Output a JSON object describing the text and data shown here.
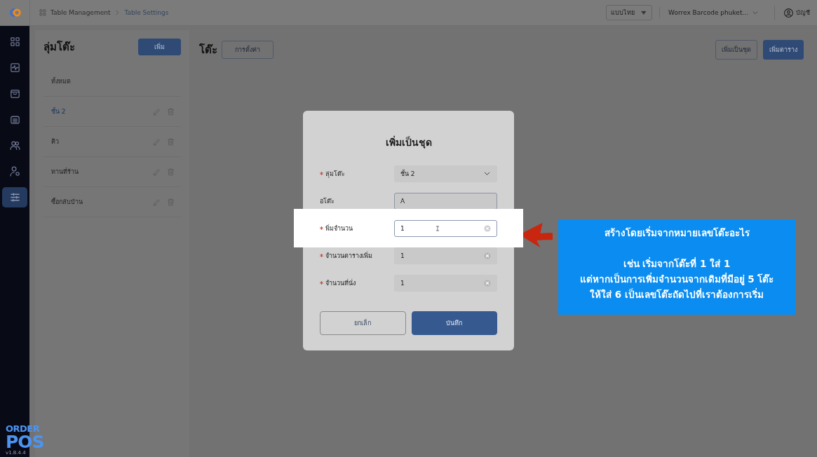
{
  "header": {
    "breadcrumb": [
      "Table Management",
      "Table Settings"
    ],
    "language": "แบบไทย",
    "store": "Worrex Barcode phuket...",
    "account": "บัญชี"
  },
  "sidebar": {
    "items": [
      {
        "kind": "grid",
        "selected": false
      },
      {
        "kind": "pulse",
        "selected": false
      },
      {
        "kind": "bag",
        "selected": false
      },
      {
        "kind": "archive",
        "selected": false
      },
      {
        "kind": "users",
        "selected": false
      },
      {
        "kind": "user-gear",
        "selected": false
      },
      {
        "kind": "sliders",
        "selected": true
      }
    ],
    "brand": {
      "line_1": "ORDER",
      "line_2": "POS",
      "version": "v1.8.4.4"
    }
  },
  "groups_panel": {
    "title": "ลุ่มโต๊ะ",
    "add_button": "เพิ่ม",
    "items": [
      {
        "label": "ทั้งหมด",
        "selected": false,
        "editable": false
      },
      {
        "label": "ชั้น 2",
        "selected": true,
        "editable": true
      },
      {
        "label": "คิว",
        "selected": false,
        "editable": true
      },
      {
        "label": "ทานที่ร้าน",
        "selected": false,
        "editable": true
      },
      {
        "label": "ซื้อกลับบ้าน",
        "selected": false,
        "editable": true
      }
    ]
  },
  "tables_panel": {
    "title": "โต๊ะ",
    "settings_button": "การตั้งค่า",
    "buttons": [
      {
        "label": "เพิ่มเป็นชุด",
        "kind": "outline"
      },
      {
        "label": "เพิ่มตาราง",
        "kind": "primary"
      }
    ]
  },
  "dialog": {
    "title": "เพิ่มเป็นชุด",
    "fields": [
      {
        "label": "ลุ่มโต๊ะ",
        "required": true,
        "kind": "select",
        "value": "ชั้น 2",
        "highlighted": false
      },
      {
        "label": "อโต๊ะ",
        "required": false,
        "kind": "text",
        "value": "A",
        "highlighted": false
      },
      {
        "label": "พิ่มจำนวน",
        "required": true,
        "kind": "number",
        "value": "1",
        "highlighted": true
      },
      {
        "label": "จำนวนตารางเพิ่ม",
        "required": true,
        "kind": "number",
        "value": "1",
        "highlighted": false
      },
      {
        "label": "จำนวนที่นั่ง",
        "required": true,
        "kind": "number",
        "value": "1",
        "highlighted": false
      }
    ],
    "cancel_button": "ยกเล็ก",
    "save_button": "บันทึก"
  },
  "callout": {
    "heading": "สร้างโดยเริ่มจากหมายเลขโต๊ะอะไร",
    "lines": [
      "เช่น เริ่มจากโต๊ะที่ 1 ใส่ 1",
      "แต่หากเป็นการเพิ่มจำนวนจากเดิมที่มีอยู่ 5 โต๊ะ",
      "ให้ใส่ 6 เป็นเลขโต๊ะถัดไปที่เราต้องการเริ่ม"
    ]
  }
}
